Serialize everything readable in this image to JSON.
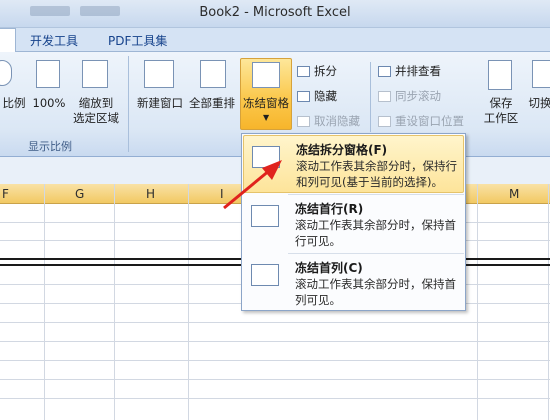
{
  "window": {
    "title": "Book2 - Microsoft Excel"
  },
  "tabs": [
    {
      "label": "开发工具"
    },
    {
      "label": "PDF工具集"
    }
  ],
  "ribbon": {
    "zoom_group": {
      "label": "显示比例",
      "buttons": [
        {
          "label": "比例"
        },
        {
          "label": "100%"
        },
        {
          "label": "缩放到\n选定区域"
        }
      ]
    },
    "window_group": {
      "new_window": "新建窗口",
      "arrange_all": "全部重排",
      "freeze_panes": "冻结窗格",
      "split": "拆分",
      "hide": "隐藏",
      "unhide": "取消隐藏",
      "view_side_by_side": "并排查看",
      "sync_scroll": "同步滚动",
      "reset_position": "重设窗口位置",
      "save_workspace": "保存\n工作区",
      "switch_windows": "切换"
    }
  },
  "sheet": {
    "columns": [
      "F",
      "G",
      "H",
      "I",
      "M"
    ]
  },
  "menu": {
    "items": [
      {
        "title": "冻结拆分窗格(F)",
        "desc": "滚动工作表其余部分时，保持行和列可见(基于当前的选择)。"
      },
      {
        "title": "冻结首行(R)",
        "desc": "滚动工作表其余部分时，保持首行可见。"
      },
      {
        "title": "冻结首列(C)",
        "desc": "滚动工作表其余部分时，保持首列可见。"
      }
    ]
  },
  "colors": {
    "highlight": "#fde49a",
    "arrow": "#e0231d",
    "column_header": "#f2c963"
  }
}
